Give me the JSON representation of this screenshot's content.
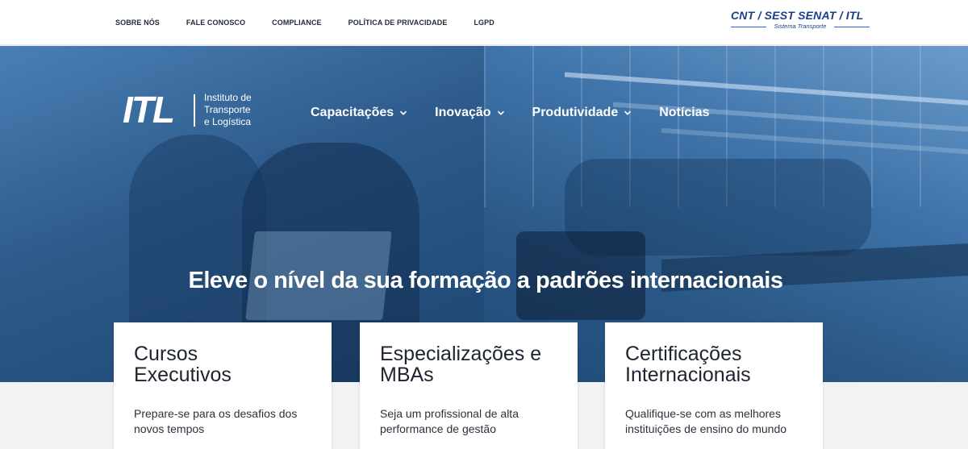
{
  "topbar": {
    "links": [
      "SOBRE NÓS",
      "FALE CONOSCO",
      "COMPLIANCE",
      "POLÍTICA DE PRIVACIDADE",
      "LGPD"
    ],
    "brand_title": "CNT / SEST SENAT / ITL",
    "brand_subtitle": "Sistema Transporte"
  },
  "logo": {
    "mark": "ITL",
    "tagline": "Instituto de\nTransporte\ne Logística"
  },
  "nav": {
    "items": [
      {
        "label": "Capacitações",
        "dropdown": true
      },
      {
        "label": "Inovação",
        "dropdown": true
      },
      {
        "label": "Produtividade",
        "dropdown": true
      },
      {
        "label": "Notícias",
        "dropdown": false
      }
    ]
  },
  "hero": {
    "headline": "Eleve o nível da sua formação a padrões internacionais"
  },
  "cards": [
    {
      "title": "Cursos\nExecutivos",
      "description": "Prepare-se para os desafios dos novos tempos"
    },
    {
      "title": "Especializações e\nMBAs",
      "description": "Seja um profissional de alta performance de gestão"
    },
    {
      "title": "Certificações\nInternacionais",
      "description": "Qualifique-se com as melhores instituições de ensino do mundo"
    }
  ],
  "colors": {
    "brand_blue": "#1a3f8a",
    "hero_overlay": "#2f5d8f",
    "card_bg": "#ffffff",
    "page_bg": "#f1f2f4"
  },
  "icons": {
    "dropdown": "chevron-down-icon"
  }
}
